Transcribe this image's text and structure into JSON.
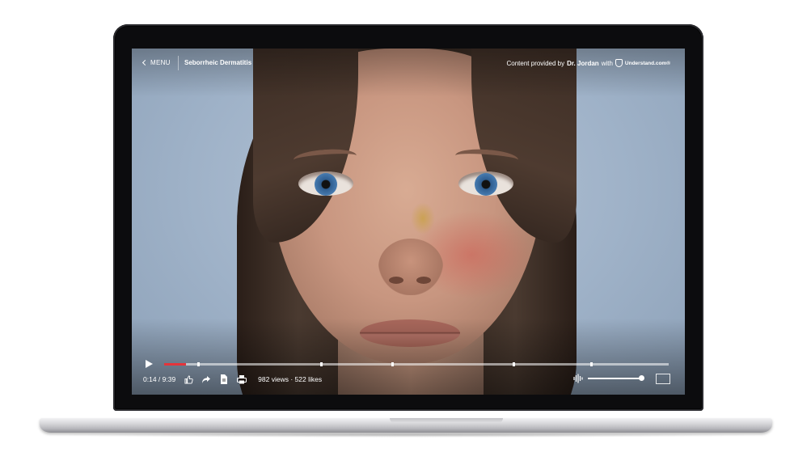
{
  "player": {
    "menu_label": "MENU",
    "title": "Seborrheic Dermatitis",
    "credit_prefix": "Content provided by",
    "credit_author": "Dr. Jordan",
    "credit_with": "with",
    "brand": "Understand.com®",
    "time": "0:14 / 9:39",
    "stats": "982 views · 522 likes",
    "progress_fraction": 0.044,
    "buffered_fraction": 0.065,
    "volume_fraction": 1.0,
    "chapter_marks": [
      0.065,
      0.31,
      0.45,
      0.69,
      0.845
    ]
  },
  "colors": {
    "progress": "#e5343a",
    "bezel": "#0c0c0e",
    "background": "#8da1b8"
  },
  "icons": [
    "play-icon",
    "thumbs-up-icon",
    "share-icon",
    "document-icon",
    "print-icon",
    "volume-icon",
    "fullscreen-icon",
    "chevron-left-icon",
    "shield-icon"
  ]
}
